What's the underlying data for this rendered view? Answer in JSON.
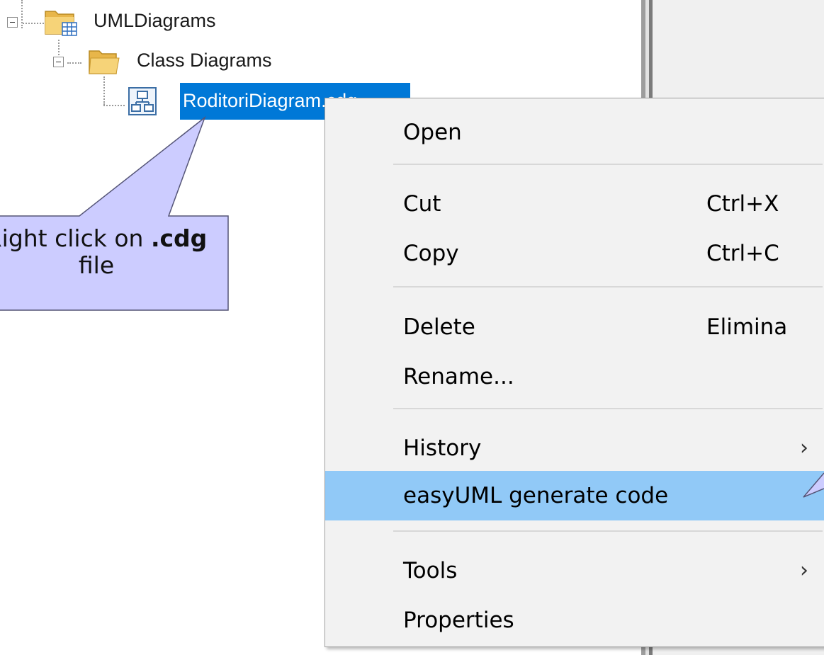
{
  "tree": {
    "root_label": "UMLDiagrams",
    "folder_label": "Class Diagrams",
    "selected_file_label": "RoditoriDiagram.cdg"
  },
  "callout": {
    "text_pre": "Right click on ",
    "text_bold": ".cdg",
    "text_post": "file"
  },
  "menu": {
    "items": [
      {
        "label": "Open",
        "shortcut": ""
      },
      {
        "label": "Cut",
        "shortcut": "Ctrl+X"
      },
      {
        "label": "Copy",
        "shortcut": "Ctrl+C"
      },
      {
        "label": "Delete",
        "shortcut": "Elimina"
      },
      {
        "label": "Rename...",
        "shortcut": ""
      },
      {
        "label": "History",
        "shortcut": "",
        "submenu_arrow": "›"
      },
      {
        "label": "easyUML generate code",
        "shortcut": "",
        "highlighted": true
      },
      {
        "label": "Tools",
        "shortcut": "",
        "submenu_arrow": "›"
      },
      {
        "label": "Properties",
        "shortcut": ""
      }
    ]
  },
  "colors": {
    "selection": "#0078d7",
    "menu_highlight": "#91c9f7",
    "callout_fill": "#ccccff",
    "folder": "#f0c451"
  }
}
